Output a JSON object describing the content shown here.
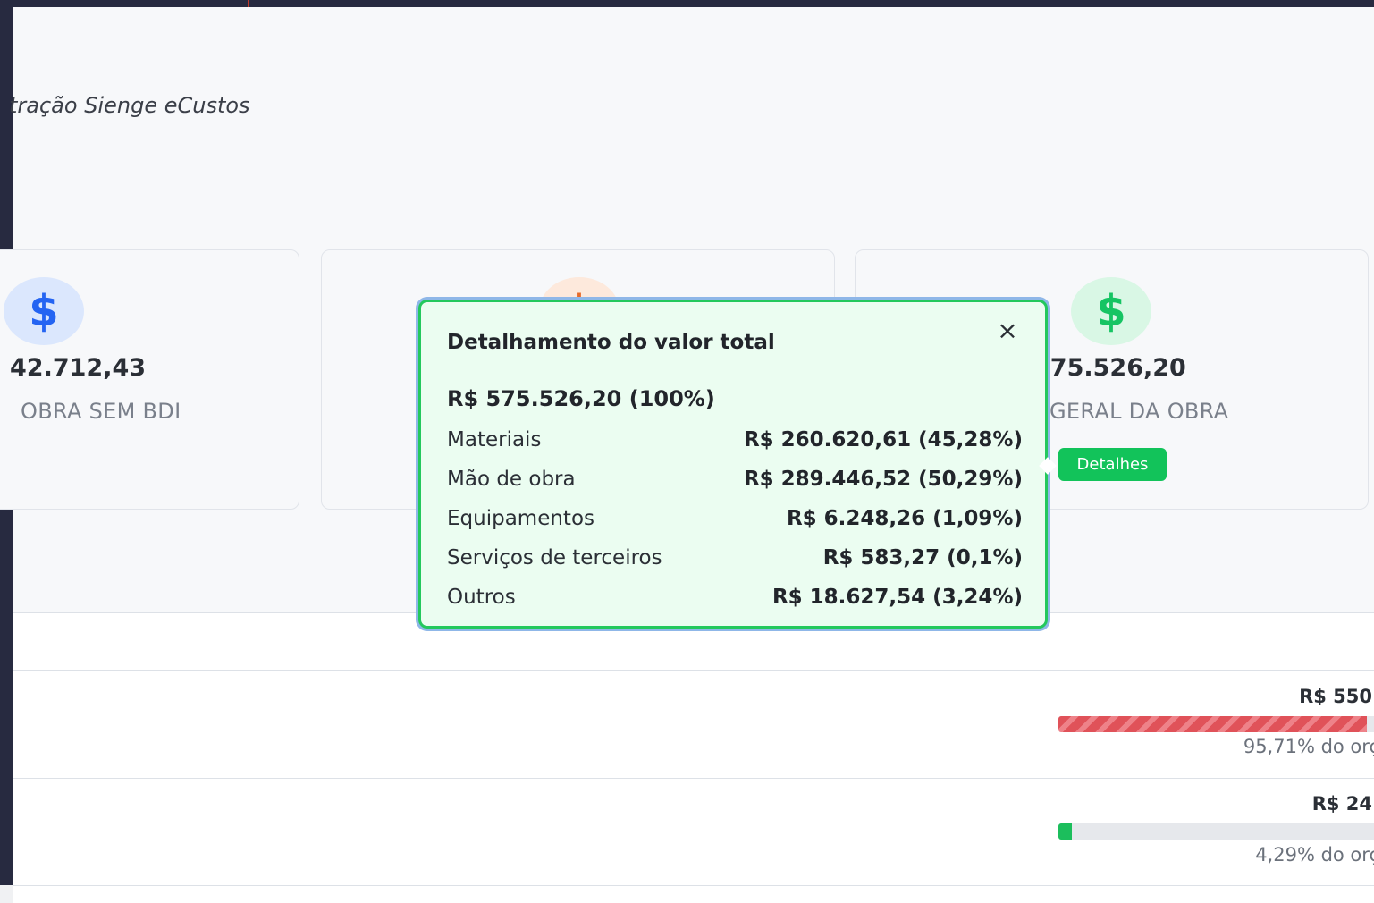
{
  "header": {
    "subtitle": "tração Sienge eCustos"
  },
  "cards": [
    {
      "icon": "dollar-icon",
      "symbol": "$",
      "value": "42.712,43",
      "label": "OBRA SEM BDI"
    },
    {
      "icon": "dollar-icon",
      "symbol": "$"
    },
    {
      "icon": "dollar-icon",
      "symbol": "$",
      "value": "575.526,20",
      "label": "GERAL DA OBRA",
      "button": "Detalhes"
    }
  ],
  "popover": {
    "title": "Detalhamento do valor total",
    "close_symbol": "×",
    "total": "R$ 575.526,20 (100%)",
    "rows": [
      {
        "label": "Materiais",
        "value": "R$ 260.620,61 (45,28%)"
      },
      {
        "label": "Mão de obra",
        "value": "R$ 289.446,52 (50,29%)"
      },
      {
        "label": "Equipamentos",
        "value": "R$ 6.248,26 (1,09%)"
      },
      {
        "label": "Serviços de terceiros",
        "value": "R$ 583,27 (0,1%)"
      },
      {
        "label": "Outros",
        "value": "R$ 18.627,54 (3,24%)"
      }
    ]
  },
  "budget_rows": [
    {
      "value": "R$ 550.",
      "percent_text": "95,71% do orç",
      "fill_percent": 95.71,
      "color": "#e05259"
    },
    {
      "value": "R$ 24.",
      "percent_text": "4,29% do orç",
      "fill_percent": 4.29,
      "color": "#1cbe5c"
    }
  ],
  "colors": {
    "accent_green": "#12c35a",
    "accent_blue": "#2464f2",
    "accent_orange": "#e76b2a",
    "sidebar": "#272a40"
  }
}
